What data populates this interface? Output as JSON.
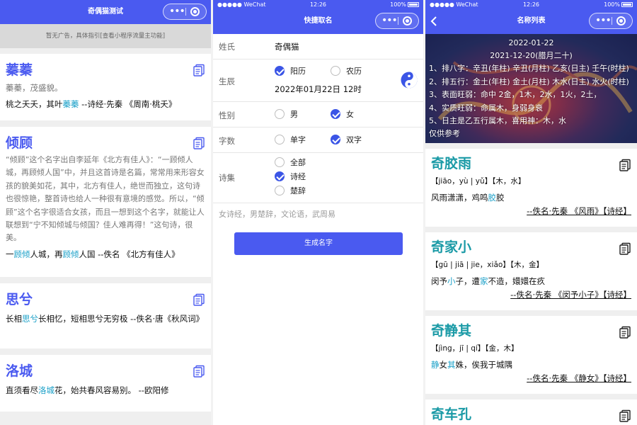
{
  "panel1": {
    "nav_title": "奇偶猫测试",
    "ad_text": "暂无广告，具体指引[查看小程序流量主功能]",
    "cards": [
      {
        "title": "蓁蓁",
        "meaning": "蓁蓁，茂盛貌。",
        "verse_pre": "桃之夭夭，其叶",
        "verse_hl": "蓁蓁",
        "verse_post": "  --诗经·先秦  《周南·桃夭》"
      },
      {
        "title": "倾顾",
        "meaning": "“倾顾”这个名字出自李延年《北方有佳人》：“一顾倾人城，再顾倾人国”中，并且这首诗是名篇，常常用来形容女孩的貌美如花，其中，北方有佳人，绝世而独立，这句诗也很惊艳，整首诗也给人一种很有意境的感觉。所以，“倾顾”这个名字很适合女孩，而且一想到这个名字，就能让人联想到“宁不知倾城与倾国？佳人难再得！”这句诗，很美。",
        "verse_a": "一",
        "verse_hl1": "顾倾",
        "verse_b": "人城，再",
        "verse_hl2": "顾倾",
        "verse_c": "人国  --佚名  《北方有佳人》"
      },
      {
        "title": "思兮",
        "verse_a": "长相",
        "verse_hl1": "思兮",
        "verse_b": "长相忆，短相思兮无穷极  --佚名·唐《秋风词》"
      },
      {
        "title": "洛城",
        "verse_a": "直须看尽",
        "verse_hl1": "洛城",
        "verse_b": "花，始共春风容易别。  --欧阳修"
      }
    ]
  },
  "panel2": {
    "status": {
      "carrier": "●●●●● WeChat",
      "time": "12:26",
      "battery": "100%"
    },
    "nav_title": "快捷取名",
    "surname": {
      "label": "姓氏",
      "value": "奇偶猫"
    },
    "birth": {
      "label": "生辰",
      "opt_solar": "阳历",
      "opt_lunar": "农历",
      "value": "2022年01月22日 12时"
    },
    "gender": {
      "label": "性别",
      "opt_male": "男",
      "opt_female": "女"
    },
    "chars": {
      "label": "字数",
      "opt_single": "单字",
      "opt_double": "双字"
    },
    "poems": {
      "label": "诗集",
      "opt_all": "全部",
      "opt_shijing": "诗经",
      "opt_chuci": "楚辞"
    },
    "hint": "女诗经，男楚辞，文论语，武周易",
    "submit": "生成名字"
  },
  "panel3": {
    "status": {
      "carrier": "●●●●● WeChat",
      "time": "12:26",
      "battery": "100%"
    },
    "nav_title": "名称列表",
    "banner": {
      "date_solar": "2022-01-22",
      "date_lunar": "2021-12-20(腊月二十)",
      "l1": "1、排八字：辛丑(年柱) 辛丑(月柱) 乙亥(日主) 壬午(时柱)",
      "l2": "2、排五行：金土(年柱) 金土(月柱) 木水(日主) 水火(时柱)",
      "l3": "3、表面旺弱：命中 2金，1木，2水，1火，2土，",
      "l4": "4、实质旺弱：命属木，身弱身衰",
      "l5": "5、日主是乙五行属木，喜用神：木，水",
      "l6": "仅供参考"
    },
    "names": [
      {
        "title": "奇胶雨",
        "pinyin": "【jiāo，yù | yǔ】【木，水】",
        "verse_a": "风雨潇潇，鸡鸣",
        "verse_hl1": "胶",
        "verse_b": "胶",
        "source": "--佚名·先秦 《风雨》【诗经】"
      },
      {
        "title": "奇家小",
        "pinyin": "【gū | jiā | jie，xiǎo】【木，金】",
        "verse_a": "闵予",
        "verse_hl1": "小",
        "verse_b": "子，遭",
        "verse_hl2": "家",
        "verse_c": "不造，嬛嬛在疚",
        "source": "--佚名·先秦 《闵予小子》【诗经】"
      },
      {
        "title": "奇静其",
        "pinyin": "【jìng，jī | qí】【金，木】",
        "verse_hl1": "静",
        "verse_a": "女",
        "verse_hl2": "其",
        "verse_b": "姝，俟我于城隅",
        "source": "--佚名·先秦 《静女》【诗经】"
      },
      {
        "title": "奇车孔"
      }
    ]
  },
  "colors": {
    "accent": "#4a5af0",
    "name_teal": "#1a9aa6",
    "highlight": "#1aa0c8"
  }
}
